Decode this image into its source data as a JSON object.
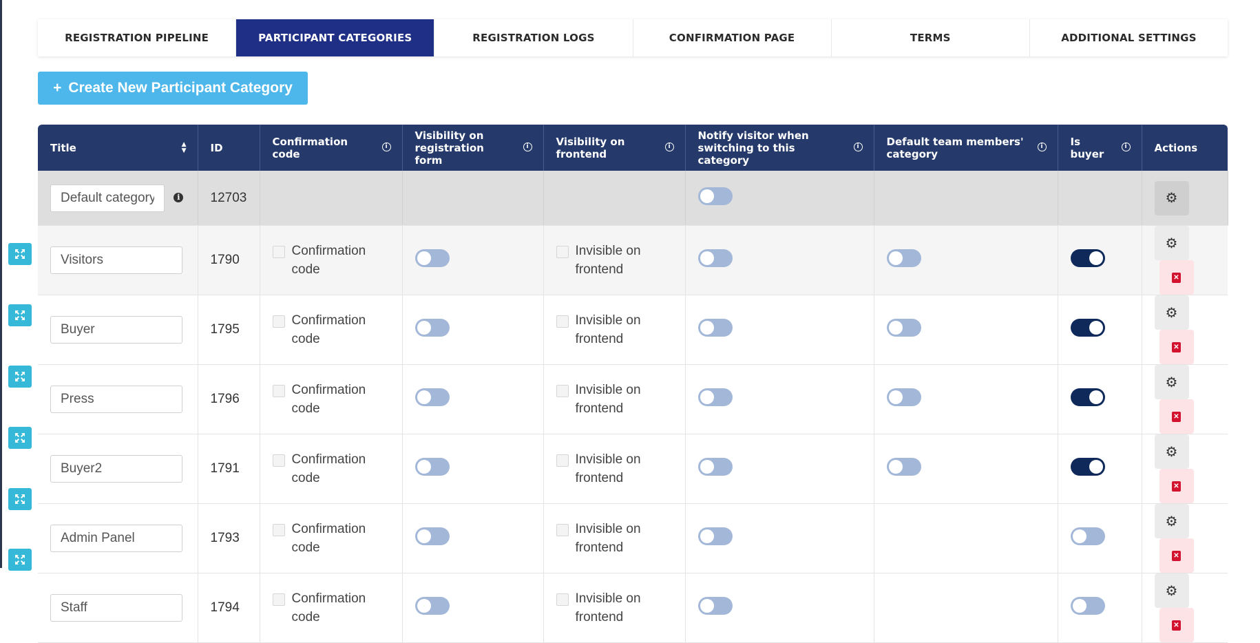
{
  "tabs": [
    {
      "label": "REGISTRATION PIPELINE",
      "active": false
    },
    {
      "label": "PARTICIPANT CATEGORIES",
      "active": true
    },
    {
      "label": "REGISTRATION LOGS",
      "active": false
    },
    {
      "label": "CONFIRMATION PAGE",
      "active": false
    },
    {
      "label": "TERMS",
      "active": false
    },
    {
      "label": "ADDITIONAL SETTINGS",
      "active": false
    }
  ],
  "create_button": {
    "icon": "+",
    "label": "Create New Participant Category"
  },
  "table": {
    "headers": {
      "title": "Title",
      "id": "ID",
      "confirmation_code": "Confirmation code",
      "visibility_form": "Visibility on registration form",
      "visibility_frontend": "Visibility on frontend",
      "notify": "Notify visitor when switching to this category",
      "default_team": "Default team members' category",
      "is_buyer": "Is buyer",
      "actions": "Actions"
    },
    "default_row": {
      "title": "Default category",
      "id": "12703",
      "notify": false
    },
    "labels": {
      "confirmation_code": "Confirmation code",
      "invisible": "Invisible on frontend"
    },
    "rows": [
      {
        "title": "Visitors",
        "id": "1790",
        "visibility_form": false,
        "notify": false,
        "default_team": false,
        "is_buyer": true
      },
      {
        "title": "Buyer",
        "id": "1795",
        "visibility_form": false,
        "notify": false,
        "default_team": false,
        "is_buyer": true
      },
      {
        "title": "Press",
        "id": "1796",
        "visibility_form": false,
        "notify": false,
        "default_team": false,
        "is_buyer": true
      },
      {
        "title": "Buyer2",
        "id": "1791",
        "visibility_form": false,
        "notify": false,
        "default_team": false,
        "is_buyer": true
      },
      {
        "title": "Admin Panel",
        "id": "1793",
        "visibility_form": false,
        "notify": false,
        "default_team": null,
        "is_buyer": false
      },
      {
        "title": "Staff",
        "id": "1794",
        "visibility_form": false,
        "notify": false,
        "default_team": null,
        "is_buyer": false
      }
    ]
  },
  "colors": {
    "tab_active": "#1f2f86",
    "header_bg": "#253a6a",
    "create_button": "#4db6ea",
    "toggle_on": "#0f2a5a",
    "toggle_off": "#a3b8d8",
    "drag_handle": "#36b9d8",
    "delete_icon": "#d2122e"
  },
  "icons": {
    "sort": "sort-icon",
    "info": "info-icon",
    "settings": "gear-icon",
    "delete": "delete-icon",
    "drag": "expand-arrows-icon"
  }
}
